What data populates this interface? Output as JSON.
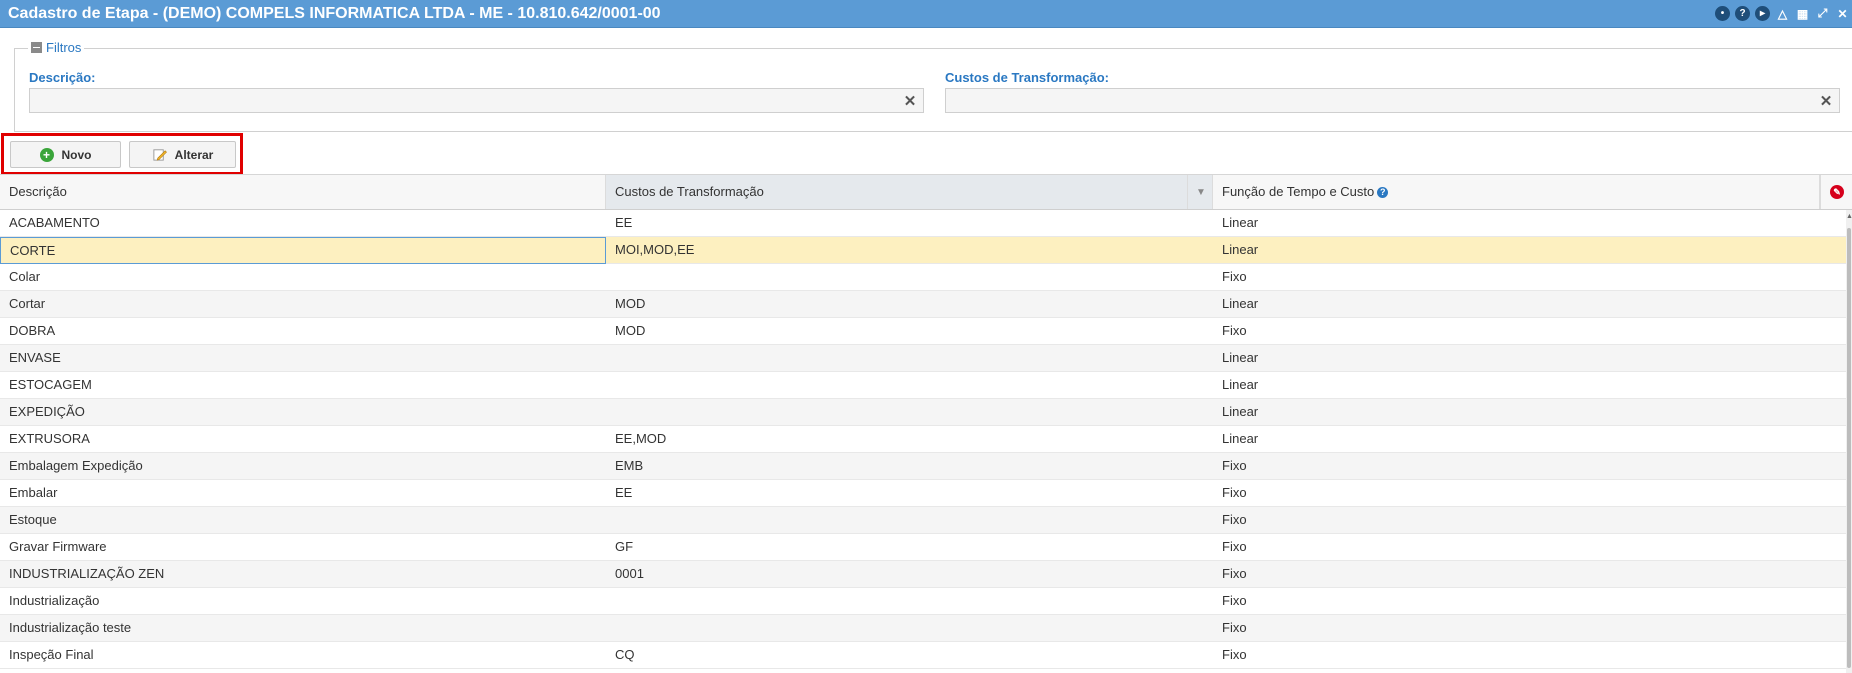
{
  "window": {
    "title": "Cadastro de Etapa - (DEMO) COMPELS INFORMATICA LTDA - ME - 10.810.642/0001-00",
    "icons": [
      "chat-icon",
      "help-icon",
      "play-icon",
      "bell-icon",
      "calendar-icon",
      "collapse-icon",
      "close-icon"
    ]
  },
  "filters": {
    "legend": "Filtros",
    "descricao_label": "Descrição:",
    "descricao_value": "",
    "custos_label": "Custos de Transformação:",
    "custos_value": ""
  },
  "toolbar": {
    "novo_label": "Novo",
    "alterar_label": "Alterar"
  },
  "grid": {
    "columns": [
      "Descrição",
      "Custos de Transformação",
      "Função de Tempo e Custo"
    ],
    "rows": [
      {
        "descricao": "ACABAMENTO",
        "custos": "EE",
        "funcao": "Linear"
      },
      {
        "descricao": "CORTE",
        "custos": "MOI,MOD,EE",
        "funcao": "Linear"
      },
      {
        "descricao": "Colar",
        "custos": "",
        "funcao": "Fixo"
      },
      {
        "descricao": "Cortar",
        "custos": "MOD",
        "funcao": "Linear"
      },
      {
        "descricao": "DOBRA",
        "custos": "MOD",
        "funcao": "Fixo"
      },
      {
        "descricao": "ENVASE",
        "custos": "",
        "funcao": "Linear"
      },
      {
        "descricao": "ESTOCAGEM",
        "custos": "",
        "funcao": "Linear"
      },
      {
        "descricao": "EXPEDIÇÃO",
        "custos": "",
        "funcao": "Linear"
      },
      {
        "descricao": "EXTRUSORA",
        "custos": "EE,MOD",
        "funcao": "Linear"
      },
      {
        "descricao": "Embalagem Expedição",
        "custos": "EMB",
        "funcao": "Fixo"
      },
      {
        "descricao": "Embalar",
        "custos": "EE",
        "funcao": "Fixo"
      },
      {
        "descricao": "Estoque",
        "custos": "",
        "funcao": "Fixo"
      },
      {
        "descricao": "Gravar Firmware",
        "custos": "GF",
        "funcao": "Fixo"
      },
      {
        "descricao": "INDUSTRIALIZAÇÃO ZEN",
        "custos": "0001",
        "funcao": "Fixo"
      },
      {
        "descricao": "Industrialização",
        "custos": "",
        "funcao": "Fixo"
      },
      {
        "descricao": "Industrialização teste",
        "custos": "",
        "funcao": "Fixo"
      },
      {
        "descricao": "Inspeção Final",
        "custos": "CQ",
        "funcao": "Fixo"
      }
    ]
  },
  "colors": {
    "titlebar": "#5b9bd5",
    "label_blue": "#2a78c2",
    "selected_row": "#fdf0c0",
    "highlight_border": "#e00000"
  }
}
